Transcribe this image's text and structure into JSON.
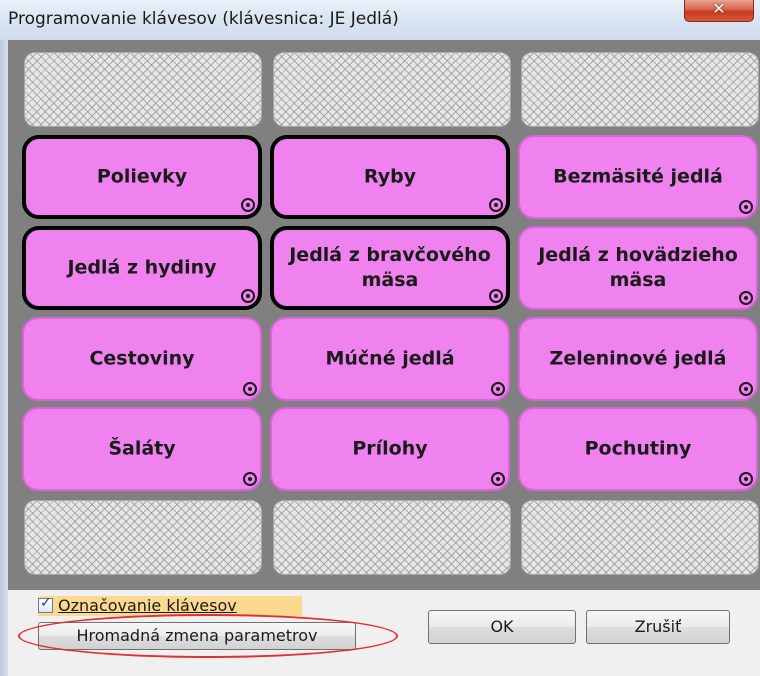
{
  "window": {
    "title": "Programovanie klávesov (klávesnica: JE  Jedlá)",
    "close_icon": "close-icon"
  },
  "keys": [
    {
      "label": "Polievky",
      "selected": true
    },
    {
      "label": "Ryby",
      "selected": true
    },
    {
      "label": "Bezmäsité jedlá",
      "selected": false
    },
    {
      "label": "Jedlá z hydiny",
      "selected": true
    },
    {
      "label": "Jedlá z bravčového\nmäsa",
      "selected": true
    },
    {
      "label": "Jedlá z hovädzieho\nmäsa",
      "selected": false
    },
    {
      "label": "Cestoviny",
      "selected": false
    },
    {
      "label": "Múčné jedlá",
      "selected": false
    },
    {
      "label": "Zeleninové jedlá",
      "selected": false
    },
    {
      "label": "Šaláty",
      "selected": false
    },
    {
      "label": "Prílohy",
      "selected": false
    },
    {
      "label": "Pochutiny",
      "selected": false
    }
  ],
  "footer": {
    "checkbox_label": "Označovanie klávesov",
    "checkbox_checked": true,
    "bulk_button": "Hromadná zmena parametrov",
    "ok_button": "OK",
    "cancel_button": "Zrušiť"
  },
  "colors": {
    "key_fill": "#ef82ef",
    "panel_background": "#808080",
    "highlight_oval": "#e0322e"
  }
}
